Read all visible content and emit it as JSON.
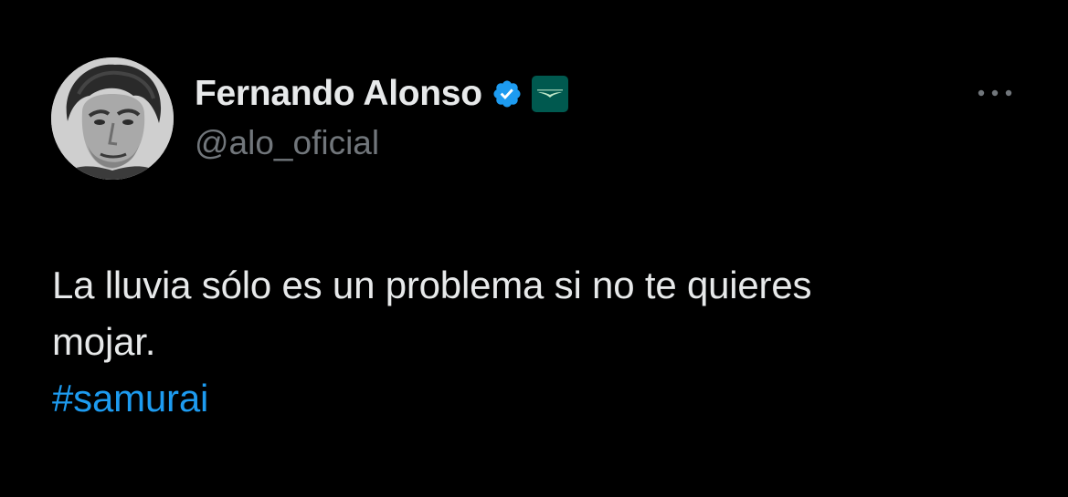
{
  "tweet": {
    "author": {
      "display_name": "Fernando Alonso",
      "handle": "@alo_oficial",
      "verified_icon": "verified-badge-icon",
      "affiliate_icon": "aston-martin-affiliate-icon"
    },
    "more_icon": "more-options-icon",
    "text_lines": [
      "La lluvia sólo es un problema si no te quieres",
      "mojar."
    ],
    "hashtag": "#samurai"
  },
  "colors": {
    "background": "#000000",
    "primary_text": "#e7e9ea",
    "secondary_text": "#71767b",
    "link": "#1d9bf0",
    "verified": "#1d9bf0",
    "affiliate_bg": "#00594f"
  }
}
